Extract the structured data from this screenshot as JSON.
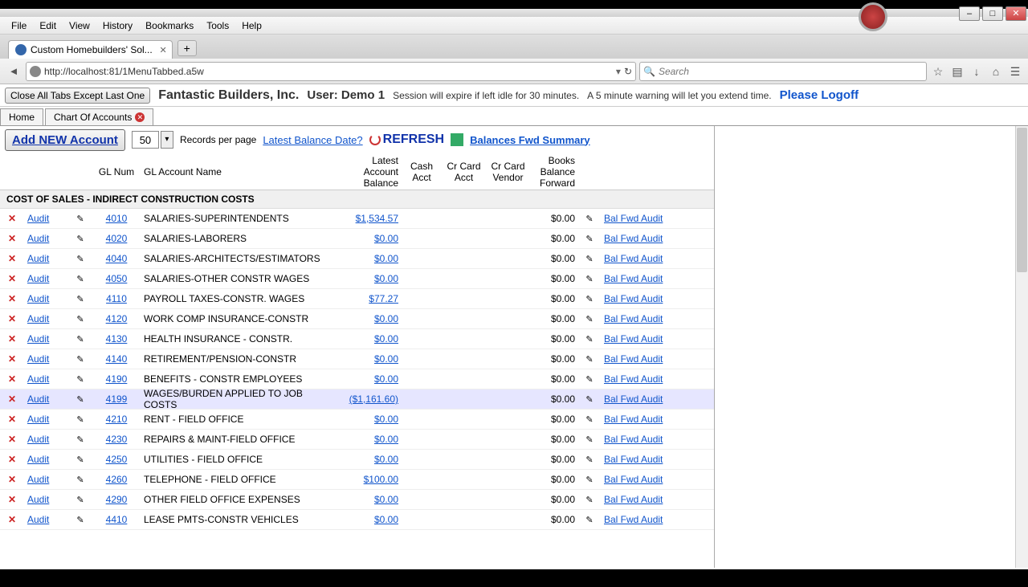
{
  "menu": {
    "items": [
      "File",
      "Edit",
      "View",
      "History",
      "Bookmarks",
      "Tools",
      "Help"
    ]
  },
  "browser_tab": {
    "title": "Custom Homebuilders' Sol..."
  },
  "url": "http://localhost:81/1MenuTabbed.a5w",
  "search_placeholder": "Search",
  "winbtns": {
    "min": "–",
    "max": "□",
    "close": "✕"
  },
  "appheader": {
    "close_all": "Close All Tabs Except Last One",
    "company": "Fantastic Builders, Inc.",
    "user_label": "User: Demo 1",
    "session1": "Session will expire if left idle for 30 minutes.",
    "session2": "A 5 minute warning will let you extend time.",
    "logoff": "Please Logoff"
  },
  "apptabs": {
    "home": "Home",
    "chart": "Chart Of Accounts"
  },
  "toolbar": {
    "add_new": "Add NEW Account",
    "page_size": "50",
    "records_per_page": "Records per page",
    "latest_balance_date": "Latest Balance Date?",
    "refresh": "REFRESH",
    "bal_fwd": "Balances Fwd Summary"
  },
  "columns": {
    "glnum": "GL Num",
    "glname": "GL Account Name",
    "latest": "Latest Account Balance",
    "cash": "Cash Acct",
    "crcard_acct": "Cr Card Acct",
    "crcard_vendor": "Cr Card Vendor",
    "books": "Books Balance Forward"
  },
  "group": "COST OF SALES - INDIRECT CONSTRUCTION COSTS",
  "rowLabels": {
    "audit": "Audit",
    "balfwd": "Bal Fwd Audit"
  },
  "rows": [
    {
      "gl": "4010",
      "name": "SALARIES-SUPERINTENDENTS",
      "bal": "$1,534.57",
      "bbf": "$0.00"
    },
    {
      "gl": "4020",
      "name": "SALARIES-LABORERS",
      "bal": "$0.00",
      "bbf": "$0.00"
    },
    {
      "gl": "4040",
      "name": "SALARIES-ARCHITECTS/ESTIMATORS",
      "bal": "$0.00",
      "bbf": "$0.00"
    },
    {
      "gl": "4050",
      "name": "SALARIES-OTHER CONSTR WAGES",
      "bal": "$0.00",
      "bbf": "$0.00"
    },
    {
      "gl": "4110",
      "name": "PAYROLL TAXES-CONSTR. WAGES",
      "bal": "$77.27",
      "bbf": "$0.00"
    },
    {
      "gl": "4120",
      "name": "WORK COMP INSURANCE-CONSTR",
      "bal": "$0.00",
      "bbf": "$0.00"
    },
    {
      "gl": "4130",
      "name": "HEALTH INSURANCE - CONSTR.",
      "bal": "$0.00",
      "bbf": "$0.00"
    },
    {
      "gl": "4140",
      "name": "RETIREMENT/PENSION-CONSTR",
      "bal": "$0.00",
      "bbf": "$0.00"
    },
    {
      "gl": "4190",
      "name": "BENEFITS - CONSTR EMPLOYEES",
      "bal": "$0.00",
      "bbf": "$0.00"
    },
    {
      "gl": "4199",
      "name": "WAGES/BURDEN APPLIED TO JOB COSTS",
      "bal": "($1,161.60)",
      "bbf": "$0.00",
      "hl": true
    },
    {
      "gl": "4210",
      "name": "RENT - FIELD OFFICE",
      "bal": "$0.00",
      "bbf": "$0.00"
    },
    {
      "gl": "4230",
      "name": "REPAIRS & MAINT-FIELD OFFICE",
      "bal": "$0.00",
      "bbf": "$0.00"
    },
    {
      "gl": "4250",
      "name": "UTILITIES - FIELD OFFICE",
      "bal": "$0.00",
      "bbf": "$0.00"
    },
    {
      "gl": "4260",
      "name": "TELEPHONE - FIELD OFFICE",
      "bal": "$100.00",
      "bbf": "$0.00"
    },
    {
      "gl": "4290",
      "name": "OTHER FIELD OFFICE EXPENSES",
      "bal": "$0.00",
      "bbf": "$0.00"
    },
    {
      "gl": "4410",
      "name": "LEASE PMTS-CONSTR VEHICLES",
      "bal": "$0.00",
      "bbf": "$0.00"
    }
  ]
}
